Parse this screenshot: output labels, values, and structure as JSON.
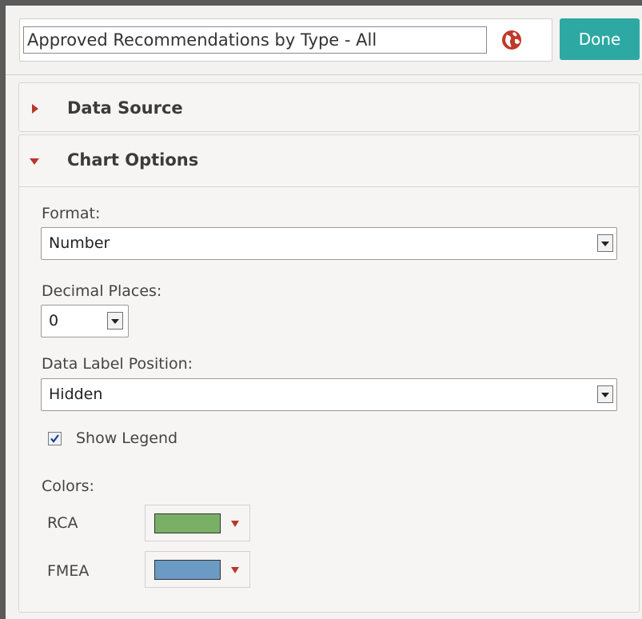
{
  "header": {
    "title_value": "Approved Recommendations by Type - All",
    "done_label": "Done"
  },
  "data_source": {
    "label": "Data Source",
    "expanded": false
  },
  "chart_options": {
    "label": "Chart Options",
    "expanded": true,
    "format": {
      "label": "Format:",
      "value": "Number"
    },
    "decimal_places": {
      "label": "Decimal Places:",
      "value": "0"
    },
    "data_label_position": {
      "label": "Data Label Position:",
      "value": "Hidden"
    },
    "show_legend": {
      "label": "Show Legend",
      "checked": true
    },
    "colors": {
      "label": "Colors:",
      "items": [
        {
          "name": "RCA",
          "color": "#79b066"
        },
        {
          "name": "FMEA",
          "color": "#6b9ac4"
        }
      ]
    }
  },
  "theme": {
    "accent": "#2ea8a3",
    "arrow_color": "#b8392a",
    "globe_color": "#c0392b"
  }
}
